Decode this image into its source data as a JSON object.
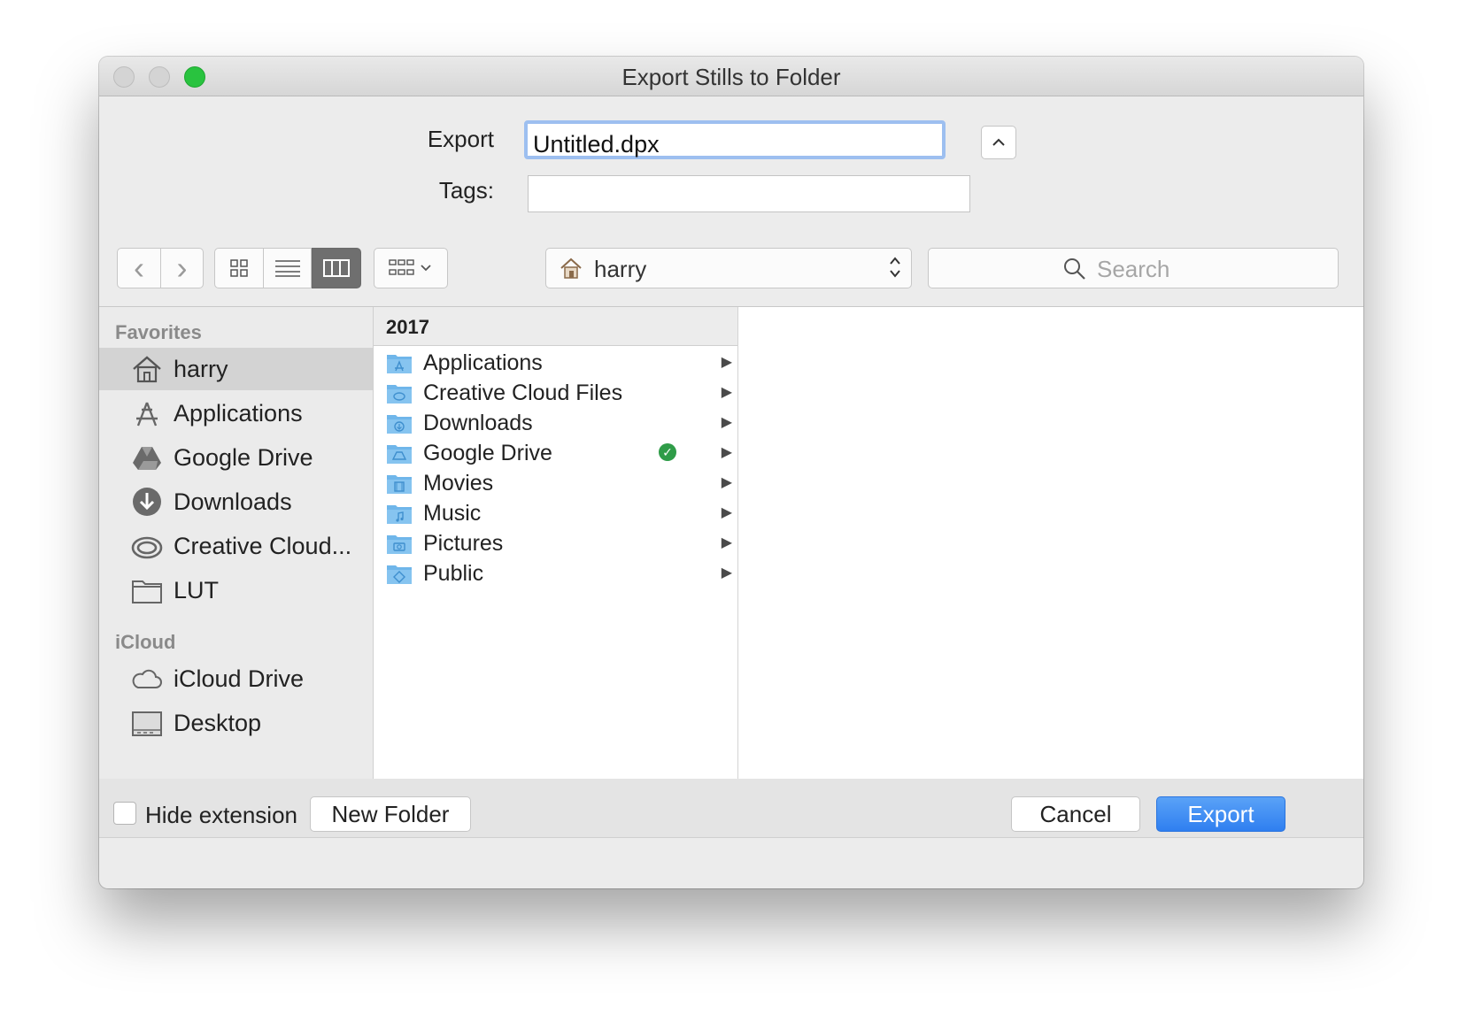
{
  "window": {
    "title": "Export Stills to Folder"
  },
  "form": {
    "export_label": "Export",
    "export_value": "Untitled.dpx",
    "tags_label": "Tags:",
    "tags_value": ""
  },
  "toolbar": {
    "back_glyph": "‹",
    "forward_glyph": "›",
    "location": "harry",
    "search_placeholder": "Search",
    "view_modes": [
      "icon-view",
      "list-view",
      "column-view"
    ],
    "active_view": "column-view"
  },
  "sidebar": {
    "favorites_header": "Favorites",
    "favorites": [
      {
        "label": "harry",
        "icon": "home-icon",
        "selected": true
      },
      {
        "label": "Applications",
        "icon": "applications-icon"
      },
      {
        "label": "Google Drive",
        "icon": "google-drive-icon"
      },
      {
        "label": "Downloads",
        "icon": "downloads-icon"
      },
      {
        "label": "Creative Cloud...",
        "icon": "creative-cloud-icon"
      },
      {
        "label": "LUT",
        "icon": "folder-icon"
      }
    ],
    "icloud_header": "iCloud",
    "icloud": [
      {
        "label": "iCloud Drive",
        "icon": "cloud-icon"
      },
      {
        "label": "Desktop",
        "icon": "desktop-icon"
      }
    ]
  },
  "browser": {
    "column_header": "2017",
    "items": [
      {
        "label": "Applications",
        "icon": "applications-folder-icon"
      },
      {
        "label": "Creative Cloud Files",
        "icon": "creative-cloud-folder-icon"
      },
      {
        "label": "Downloads",
        "icon": "downloads-folder-icon"
      },
      {
        "label": "Google Drive",
        "icon": "google-drive-folder-icon",
        "synced": true
      },
      {
        "label": "Movies",
        "icon": "movies-folder-icon"
      },
      {
        "label": "Music",
        "icon": "music-folder-icon"
      },
      {
        "label": "Pictures",
        "icon": "pictures-folder-icon"
      },
      {
        "label": "Public",
        "icon": "public-folder-icon"
      }
    ]
  },
  "bottom": {
    "hide_extension_label": "Hide extension",
    "hide_extension_checked": false,
    "new_folder_label": "New Folder",
    "cancel_label": "Cancel",
    "export_label": "Export"
  },
  "colors": {
    "accent": "#2f7ff0",
    "focus_ring": "#9dbff0",
    "folder": "#6fb6ea",
    "sync_ok": "#2f9c48",
    "zoom_button": "#29c33f"
  }
}
